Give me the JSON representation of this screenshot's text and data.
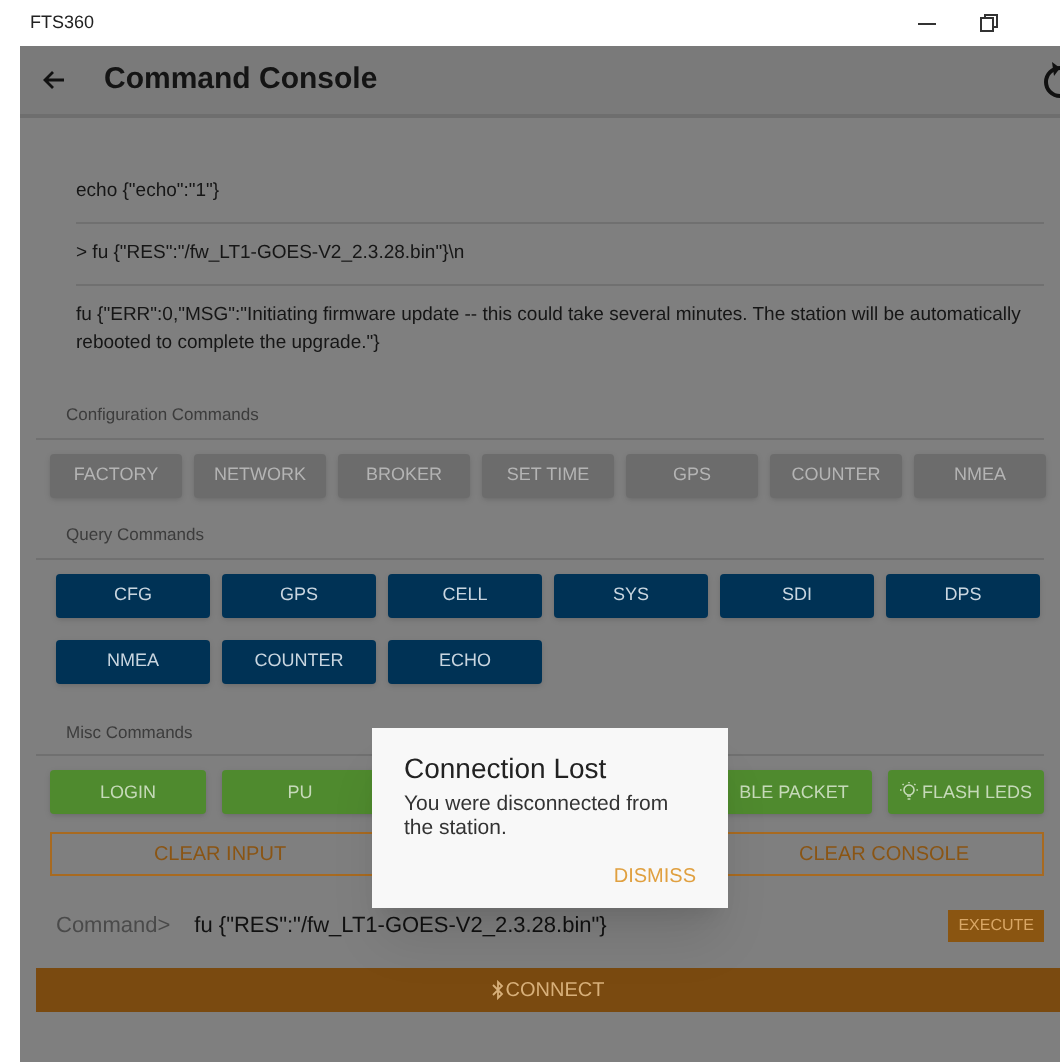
{
  "window": {
    "title": "FTS360"
  },
  "header": {
    "title": "Command Console"
  },
  "console_lines": [
    "echo {\"echo\":\"1\"}",
    "> fu {\"RES\":\"/fw_LT1-GOES-V2_2.3.28.bin\"}\\n",
    "fu {\"ERR\":0,\"MSG\":\"Initiating firmware update -- this could take several minutes. The station will be automatically rebooted to complete the upgrade.\"}"
  ],
  "sections": [
    {
      "label": "Configuration Commands",
      "kind": "config",
      "buttons": [
        {
          "label": "FACTORY",
          "disabled": true
        },
        {
          "label": "NETWORK",
          "disabled": true
        },
        {
          "label": "BROKER",
          "disabled": true
        },
        {
          "label": "SET TIME",
          "disabled": true
        },
        {
          "label": "GPS",
          "disabled": true
        },
        {
          "label": "COUNTER",
          "disabled": true
        },
        {
          "label": "NMEA",
          "disabled": true
        }
      ]
    },
    {
      "label": "Query Commands",
      "kind": "query",
      "buttons": [
        {
          "label": "CFG",
          "disabled": false
        },
        {
          "label": "GPS",
          "disabled": false
        },
        {
          "label": "CELL",
          "disabled": false
        },
        {
          "label": "SYS",
          "disabled": false
        },
        {
          "label": "SDI",
          "disabled": false
        },
        {
          "label": "DPS",
          "disabled": false
        },
        {
          "label": "NMEA",
          "disabled": false
        },
        {
          "label": "COUNTER",
          "disabled": false
        },
        {
          "label": "ECHO",
          "disabled": false
        }
      ]
    },
    {
      "label": "Misc Commands",
      "kind": "misc",
      "buttons": [
        {
          "label": "LOGIN",
          "disabled": false
        },
        {
          "label": "PU",
          "disabled": false
        },
        {
          "label": "BLE PACKET",
          "disabled": false
        },
        {
          "label": "FLASH LEDS",
          "disabled": false,
          "kind": "lamp"
        }
      ]
    }
  ],
  "clear_buttons": [
    "CLEAR INPUT",
    "CLEAR CONSOLE"
  ],
  "command": {
    "label": "Command>",
    "value": "fu {\"RES\":\"/fw_LT1-GOES-V2_2.3.28.bin\"}",
    "button": "EXECUTE"
  },
  "connect_button": "CONNECT",
  "dialog": {
    "title": "Connection Lost",
    "message": "You were disconnected from the station.",
    "button": "DISMISS"
  }
}
